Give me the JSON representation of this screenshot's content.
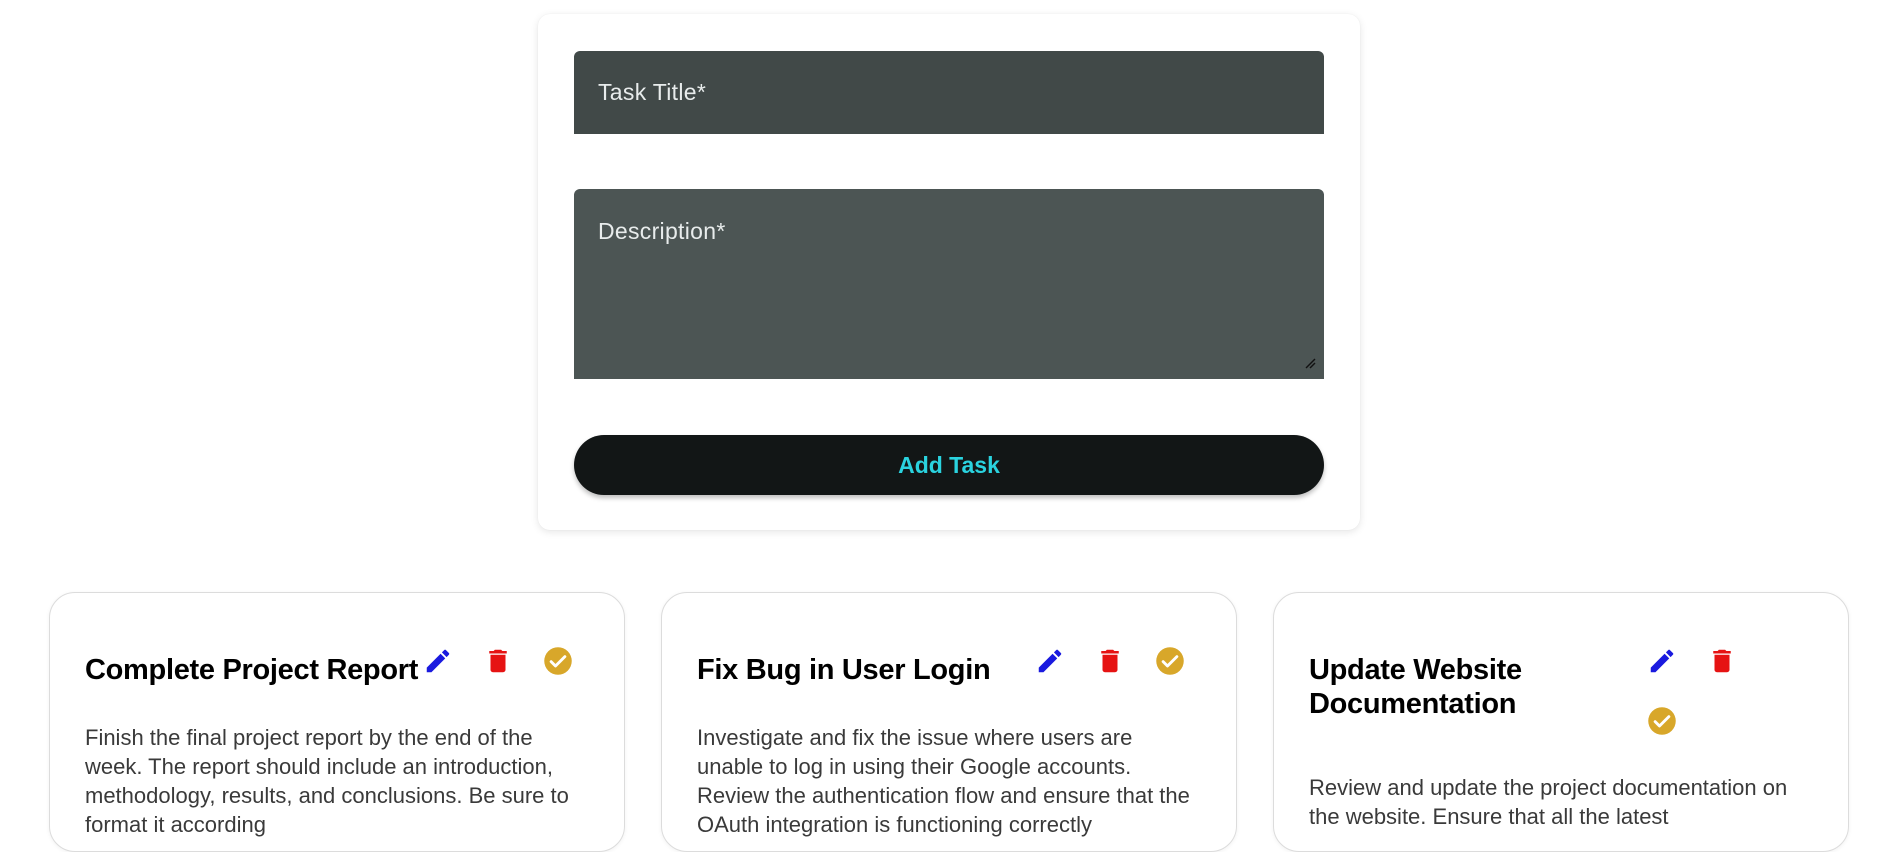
{
  "form": {
    "title_label": "Task Title*",
    "description_label": "Description*",
    "add_button_label": "Add Task"
  },
  "colors": {
    "edit_icon": "#1a1adf",
    "delete_icon": "#e61313",
    "complete_icon": "#d8a72a",
    "add_button_text": "#2ad3df"
  },
  "icons": {
    "edit": "pencil-icon",
    "delete": "trash-icon",
    "complete": "check-circle-icon"
  },
  "tasks": [
    {
      "title": "Complete Project Report",
      "description": "Finish the final project report by the end of the week. The report should include an introduction, methodology, results, and conclusions. Be sure to format it according"
    },
    {
      "title": "Fix Bug in User Login",
      "description": "Investigate and fix the issue where users are unable to log in using their Google accounts. Review the authentication flow and ensure that the OAuth integration is functioning correctly"
    },
    {
      "title": "Update Website Documentation",
      "description": "Review and update the project documentation on the website. Ensure that all the latest"
    }
  ]
}
